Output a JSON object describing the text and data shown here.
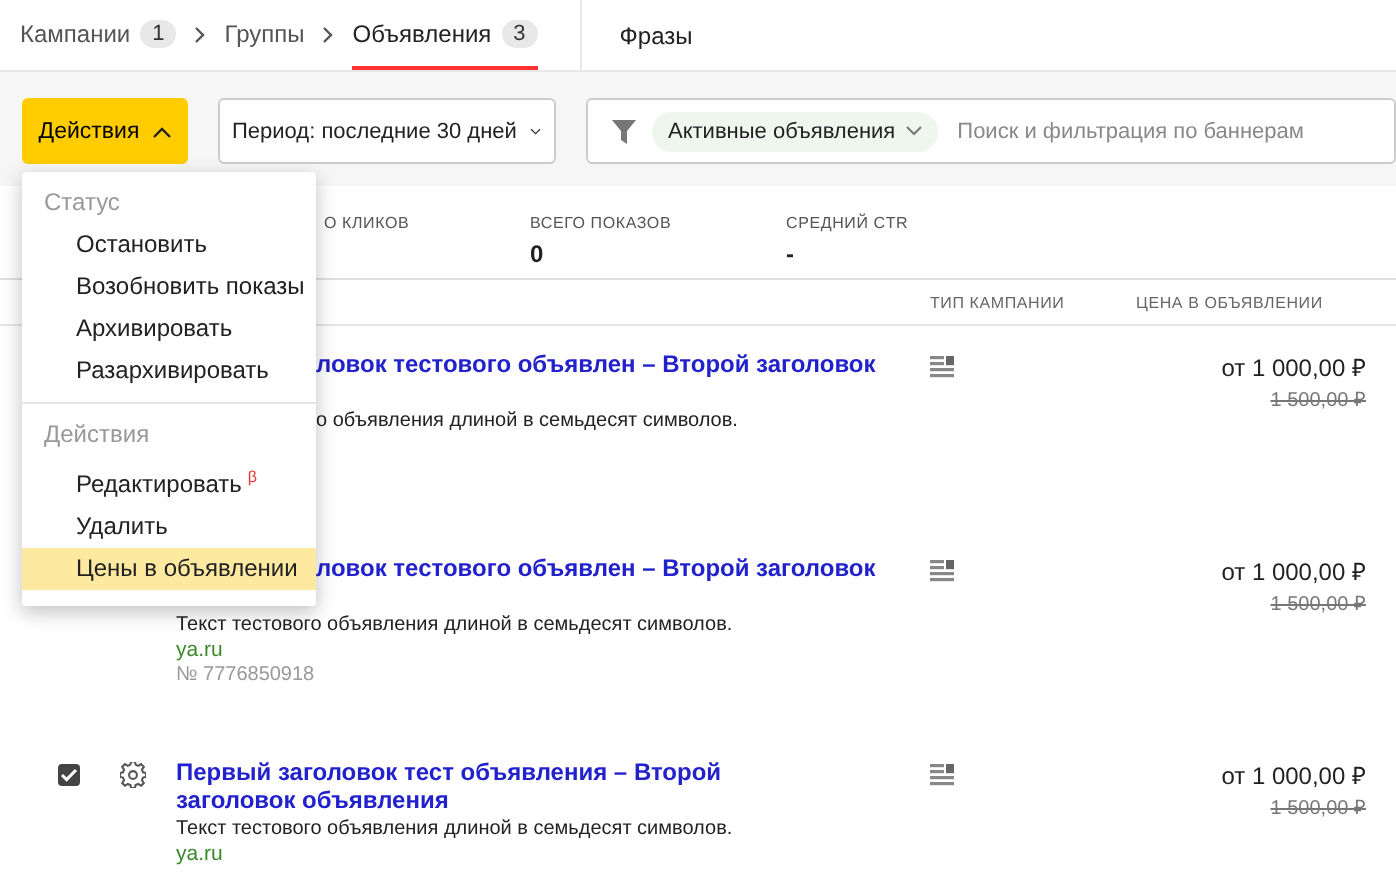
{
  "breadcrumbs": [
    {
      "label": "Кампании",
      "count": "1",
      "selected": false
    },
    {
      "label": "Группы",
      "selected": false
    },
    {
      "label": "Объявления",
      "count": "3",
      "selected": true
    }
  ],
  "tabs": [
    {
      "label": "Фразы",
      "selected": false
    }
  ],
  "toolbar": {
    "actions_button": "Действия",
    "period": "Период: последние 30 дней",
    "filter_chip": "Активные объявления",
    "search": {
      "placeholder": "Поиск и фильтрация по баннерам"
    }
  },
  "stats": [
    {
      "label": "О КЛИКОВ"
    },
    {
      "label": "ВСЕГО ПОКАЗОВ",
      "value": "0"
    },
    {
      "label": "СРЕДНИЙ CTR",
      "value": "-"
    }
  ],
  "columns": [
    "ТИП КАМПАНИИ",
    "ЦЕНА В ОБЪЯВЛЕНИИ"
  ],
  "rows": [
    {
      "title_lines": [
        {
          "text": "ловок тестового объявлен – Второй заголовок",
          "partly_hidden": true
        }
      ],
      "text": {
        "text": "о объявления длиной в семьдесят символов.",
        "partly_hidden": true
      },
      "price": "от 1 000,00 ₽",
      "old_price": "1 500,00 ₽"
    },
    {
      "title_lines": [
        {
          "text": "ловок тестового объявлен – Второй заголовок",
          "partly_hidden": true
        }
      ],
      "text": {
        "text": "Текст тестового объявления длиной в семьдесят символов."
      },
      "url": "ya.ru",
      "number": "№ 7776850918",
      "price": "от 1 000,00 ₽",
      "old_price": "1 500,00 ₽"
    },
    {
      "checked": true,
      "title_lines": [
        {
          "text": "Первый заголовок тест объявления – Второй заголовок объявления"
        }
      ],
      "text": {
        "text": "Текст тестового объявления длиной в семьдесят символов."
      },
      "url": "ya.ru",
      "price": "от 1 000,00 ₽",
      "old_price": "1 500,00 ₽"
    }
  ],
  "menu": {
    "sections": [
      {
        "heading": "Статус",
        "items": [
          {
            "label": "Остановить",
            "selected": false
          },
          {
            "label": "Возобновить показы",
            "selected": false
          },
          {
            "label": "Архивировать",
            "selected": false
          },
          {
            "label": "Разархивировать",
            "selected": false
          }
        ]
      },
      {
        "heading": "Действия",
        "items": [
          {
            "label": "Редактировать",
            "badge": "β",
            "selected": false
          },
          {
            "label": "Удалить",
            "selected": false
          },
          {
            "label": "Цены в объявлении",
            "selected": true
          }
        ]
      }
    ]
  }
}
